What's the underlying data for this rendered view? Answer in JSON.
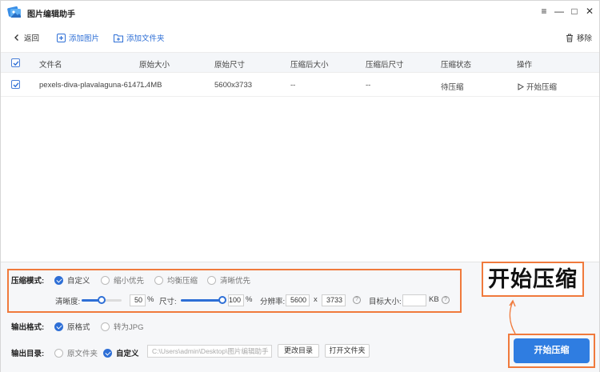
{
  "app": {
    "title": "图片编辑助手"
  },
  "window_controls": {
    "menu": "≡",
    "minimize": "—",
    "maximize": "□",
    "close": "✕"
  },
  "toolbar": {
    "back": "返回",
    "add_image": "添加图片",
    "add_folder": "添加文件夹",
    "remove": "移除"
  },
  "table": {
    "columns": [
      "文件名",
      "原始大小",
      "原始尺寸",
      "压缩后大小",
      "压缩后尺寸",
      "压缩状态",
      "操作"
    ],
    "rows": [
      {
        "filename": "pexels-diva-plavalaguna-6147...",
        "size": "1.4MB",
        "dimensions": "5600x3733",
        "compressed_size": "--",
        "compressed_dimensions": "--",
        "status": "待压缩",
        "action": "开始压缩"
      }
    ]
  },
  "compress_mode": {
    "label": "压缩模式:",
    "options": [
      "自定义",
      "缩小优先",
      "均衡压缩",
      "清晰优先"
    ],
    "selected": "自定义",
    "clarity_label": "清晰度:",
    "clarity_value": "50",
    "clarity_fraction": 0.5,
    "size_label": "尺寸:",
    "size_value": "100",
    "size_fraction": 1.0,
    "percent": "%",
    "resolution_label": "分辨率:",
    "res_w": "5600",
    "res_x": "x",
    "res_h": "3733",
    "target_label": "目标大小:",
    "target_value": "",
    "target_unit": "KB",
    "help": "?"
  },
  "output_format": {
    "label": "输出格式:",
    "options": [
      "原格式",
      "转为JPG"
    ],
    "selected": "原格式"
  },
  "output_dir": {
    "label": "输出目录:",
    "options": [
      "原文件夹",
      "自定义"
    ],
    "selected": "自定义",
    "path": "C:\\Users\\admin\\Desktop\\图片编辑助手",
    "change_button": "更改目录",
    "open_button": "打开文件夹"
  },
  "start_button": "开始压缩",
  "callout_text": "开始压缩",
  "colors": {
    "accent": "#2e6fd6",
    "highlight": "#f07a3c",
    "button": "#2f7de1"
  }
}
